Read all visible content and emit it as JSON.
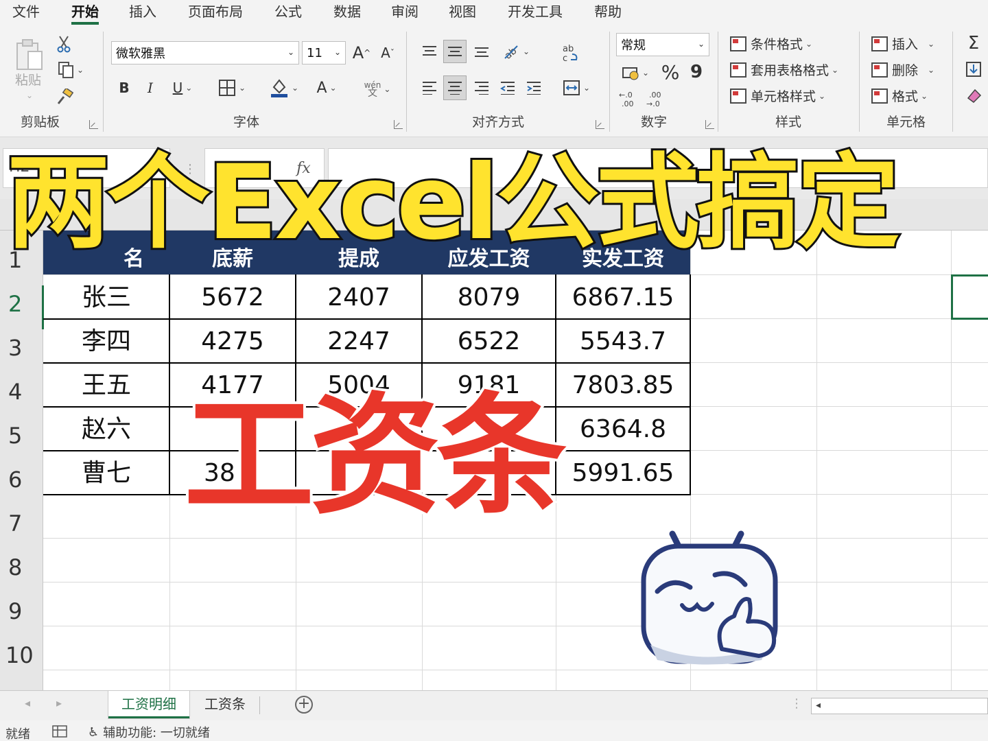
{
  "ribbon_tabs": [
    "文件",
    "开始",
    "插入",
    "页面布局",
    "公式",
    "数据",
    "审阅",
    "视图",
    "开发工具",
    "帮助"
  ],
  "active_tab": "开始",
  "clipboard": {
    "paste_label": "粘贴",
    "group_label": "剪贴板"
  },
  "font": {
    "name": "微软雅黑",
    "size": "11",
    "group_label": "字体",
    "wen_label": "wén",
    "wen_char": "文"
  },
  "alignment": {
    "group_label": "对齐方式"
  },
  "number": {
    "format": "常规",
    "group_label": "数字",
    "percent": "%",
    "comma": "9"
  },
  "styles": {
    "conditional": "条件格式",
    "table_format": "套用表格格式",
    "cell_style": "单元格样式",
    "group_label": "样式"
  },
  "cells": {
    "insert": "插入",
    "delete": "删除",
    "format": "格式",
    "group_label": "单元格"
  },
  "formula_bar": {
    "name_box": "H2",
    "fx": "fx",
    "cancel": "×",
    "confirm": "✓"
  },
  "sheet": {
    "row_numbers": [
      "1",
      "2",
      "3",
      "4",
      "5",
      "6",
      "7",
      "8",
      "9",
      "10"
    ],
    "headers": [
      "名",
      "底薪",
      "提成",
      "应发工资",
      "实发工资"
    ],
    "rows": [
      [
        "张三",
        "5672",
        "2407",
        "8079",
        "6867.15"
      ],
      [
        "李四",
        "4275",
        "2247",
        "6522",
        "5543.7"
      ],
      [
        "王五",
        "4177",
        "5004",
        "9181",
        "7803.85"
      ],
      [
        "赵六",
        "",
        "",
        "",
        "6364.8"
      ],
      [
        "曹七",
        "38",
        "",
        "",
        "5991.65"
      ]
    ]
  },
  "overlay": {
    "title": "两个Excel公式搞定",
    "subtitle": "工资条"
  },
  "sheet_tabs": [
    "工资明细",
    "工资条"
  ],
  "active_sheet": "工资明细",
  "status": {
    "ready": "就绪",
    "accessibility": "辅助功能: 一切就绪"
  }
}
